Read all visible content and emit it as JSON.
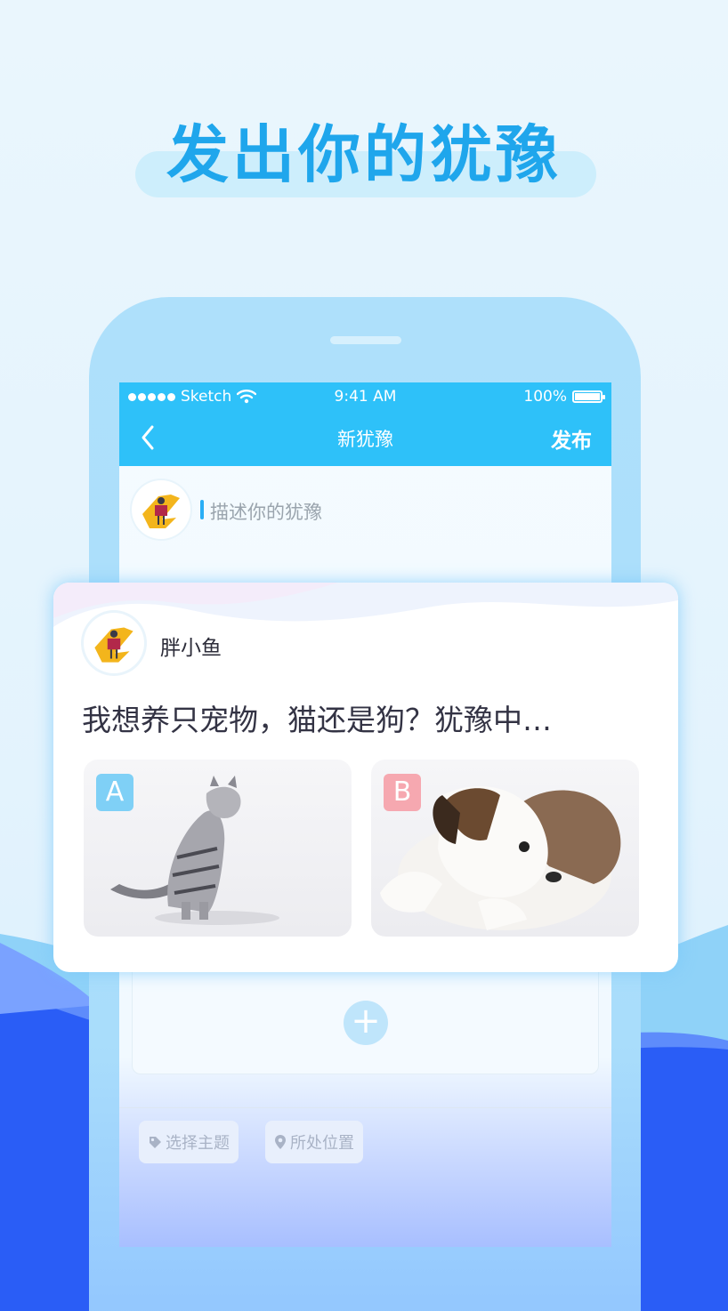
{
  "headline": "发出你的犹豫",
  "status_bar": {
    "carrier": "Sketch",
    "time": "9:41 AM",
    "battery": "100%"
  },
  "nav": {
    "title": "新犹豫",
    "action": "发布"
  },
  "composer": {
    "placeholder": "描述你的犹豫"
  },
  "card": {
    "username": "胖小鱼",
    "question": "我想养只宠物，猫还是狗？犹豫中…",
    "options": [
      {
        "label": "A",
        "image": "cat"
      },
      {
        "label": "B",
        "image": "puppy"
      }
    ]
  },
  "add_option_icon": "plus-icon",
  "tags": [
    {
      "label": "选择主题",
      "icon": "tag-icon"
    },
    {
      "label": "所处位置",
      "icon": "location-pin-icon"
    }
  ],
  "colors": {
    "accent": "#2ec1f9",
    "headline": "#1fa6ec",
    "wave_dark": "#2a5df6",
    "wave_light": "#7aa2ff"
  }
}
